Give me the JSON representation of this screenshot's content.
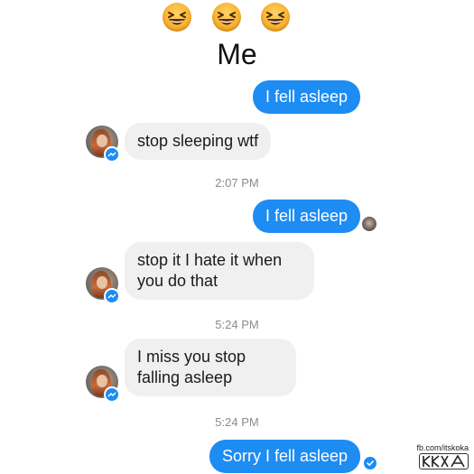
{
  "header": {
    "emojis": [
      "laughing-emoji",
      "laughing-emoji",
      "laughing-emoji"
    ],
    "title": "Me"
  },
  "messages": [
    {
      "type": "out",
      "text": "I fell asleep"
    },
    {
      "type": "in",
      "text": "stop sleeping wtf"
    },
    {
      "type": "time",
      "text": "2:07 PM"
    },
    {
      "type": "out",
      "text": "I fell asleep"
    },
    {
      "type": "in",
      "text": "stop it I hate it when you do that"
    },
    {
      "type": "time",
      "text": "5:24 PM"
    },
    {
      "type": "in",
      "text": "I miss you stop falling asleep"
    },
    {
      "type": "time",
      "text": "5:24 PM"
    },
    {
      "type": "out",
      "text": "Sorry I fell asleep"
    }
  ],
  "watermark": {
    "url": "fb.com/itskoka",
    "logo_text": "KOKA"
  },
  "colors": {
    "outgoing_bubble": "#1d8cf3",
    "incoming_bubble": "#f0f0f0",
    "timestamp": "#8b8b8b"
  }
}
